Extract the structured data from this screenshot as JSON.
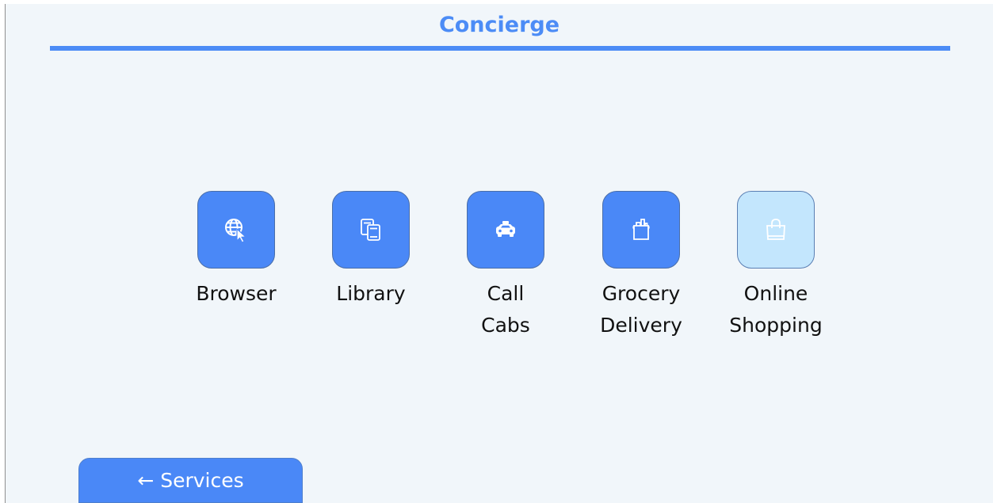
{
  "header": {
    "title": "Concierge"
  },
  "colors": {
    "accent": "#4c8cf6",
    "tile_active": "#4a88f7",
    "tile_disabled": "#c3e6fd",
    "background": "#f1f6fa"
  },
  "tiles": [
    {
      "label": "Browser",
      "icon": "globe-cursor-icon",
      "enabled": true
    },
    {
      "label": "Library",
      "icon": "books-icon",
      "enabled": true
    },
    {
      "label": "Call\nCabs",
      "icon": "taxi-icon",
      "enabled": true
    },
    {
      "label": "Grocery\nDelivery",
      "icon": "grocery-bag-icon",
      "enabled": true
    },
    {
      "label": "Online\nShopping",
      "icon": "shopping-bag-icon",
      "enabled": false
    }
  ],
  "footer": {
    "back_label": "← Services"
  }
}
